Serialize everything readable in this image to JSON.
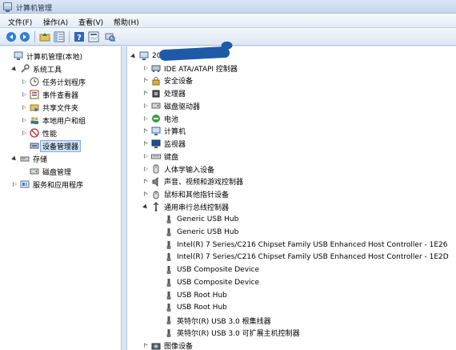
{
  "window": {
    "title": "计算机管理"
  },
  "menu": [
    "文件(F)",
    "操作(A)",
    "查看(V)",
    "帮助(H)"
  ],
  "toolbar": [
    "back-icon",
    "forward-icon",
    "up-folder-icon",
    "show-tree-icon",
    "help-icon",
    "properties-icon",
    "scan-hardware-icon"
  ],
  "left_tree": [
    {
      "label": "计算机管理(本地)",
      "icon": "computer-management-icon",
      "expander": "none",
      "level": 0
    },
    {
      "label": "系统工具",
      "icon": "system-tools-icon",
      "expander": "open",
      "level": 1
    },
    {
      "label": "任务计划程序",
      "icon": "task-scheduler-icon",
      "expander": "closed",
      "level": 2
    },
    {
      "label": "事件查看器",
      "icon": "event-viewer-icon",
      "expander": "closed",
      "level": 2
    },
    {
      "label": "共享文件夹",
      "icon": "shared-folder-icon",
      "expander": "closed",
      "level": 2
    },
    {
      "label": "本地用户和组",
      "icon": "users-icon",
      "expander": "closed",
      "level": 2
    },
    {
      "label": "性能",
      "icon": "performance-icon",
      "expander": "closed",
      "level": 2
    },
    {
      "label": "设备管理器",
      "icon": "device-manager-icon",
      "expander": "none",
      "level": 2,
      "selected": true
    },
    {
      "label": "存储",
      "icon": "storage-icon",
      "expander": "open",
      "level": 1
    },
    {
      "label": "磁盘管理",
      "icon": "disk-management-icon",
      "expander": "none",
      "level": 2
    },
    {
      "label": "服务和应用程序",
      "icon": "services-icon",
      "expander": "closed",
      "level": 1
    }
  ],
  "device_tree": {
    "root_label": "20",
    "categories": [
      {
        "label": "IDE ATA/ATAPI 控制器",
        "icon": "ide-controller-icon",
        "expander": "closed"
      },
      {
        "label": "安全设备",
        "icon": "security-device-icon",
        "expander": "closed"
      },
      {
        "label": "处理器",
        "icon": "processor-icon",
        "expander": "closed"
      },
      {
        "label": "磁盘驱动器",
        "icon": "disk-drive-icon",
        "expander": "closed"
      },
      {
        "label": "电池",
        "icon": "battery-icon",
        "expander": "closed"
      },
      {
        "label": "计算机",
        "icon": "computer-icon",
        "expander": "closed"
      },
      {
        "label": "监视器",
        "icon": "monitor-icon",
        "expander": "closed"
      },
      {
        "label": "键盘",
        "icon": "keyboard-icon",
        "expander": "closed"
      },
      {
        "label": "人体学输入设备",
        "icon": "hid-icon",
        "expander": "closed"
      },
      {
        "label": "声音、视频和游戏控制器",
        "icon": "sound-icon",
        "expander": "closed"
      },
      {
        "label": "鼠标和其他指针设备",
        "icon": "mouse-icon",
        "expander": "closed"
      },
      {
        "label": "通用串行总线控制器",
        "icon": "usb-icon",
        "expander": "open"
      }
    ],
    "usb_devices": [
      "Generic USB Hub",
      "Generic USB Hub",
      "Intel(R) 7 Series/C216 Chipset Family USB Enhanced Host Controller - 1E26",
      "Intel(R) 7 Series/C216 Chipset Family USB Enhanced Host Controller - 1E2D",
      "USB Composite Device",
      "USB Composite Device",
      "USB Root Hub",
      "USB Root Hub",
      "英特尔(R) USB 3.0 根集线器",
      "英特尔(R) USB 3.0 可扩展主机控制器"
    ],
    "trailing_category": {
      "label": "图像设备",
      "icon": "imaging-device-icon",
      "expander": "closed"
    }
  }
}
